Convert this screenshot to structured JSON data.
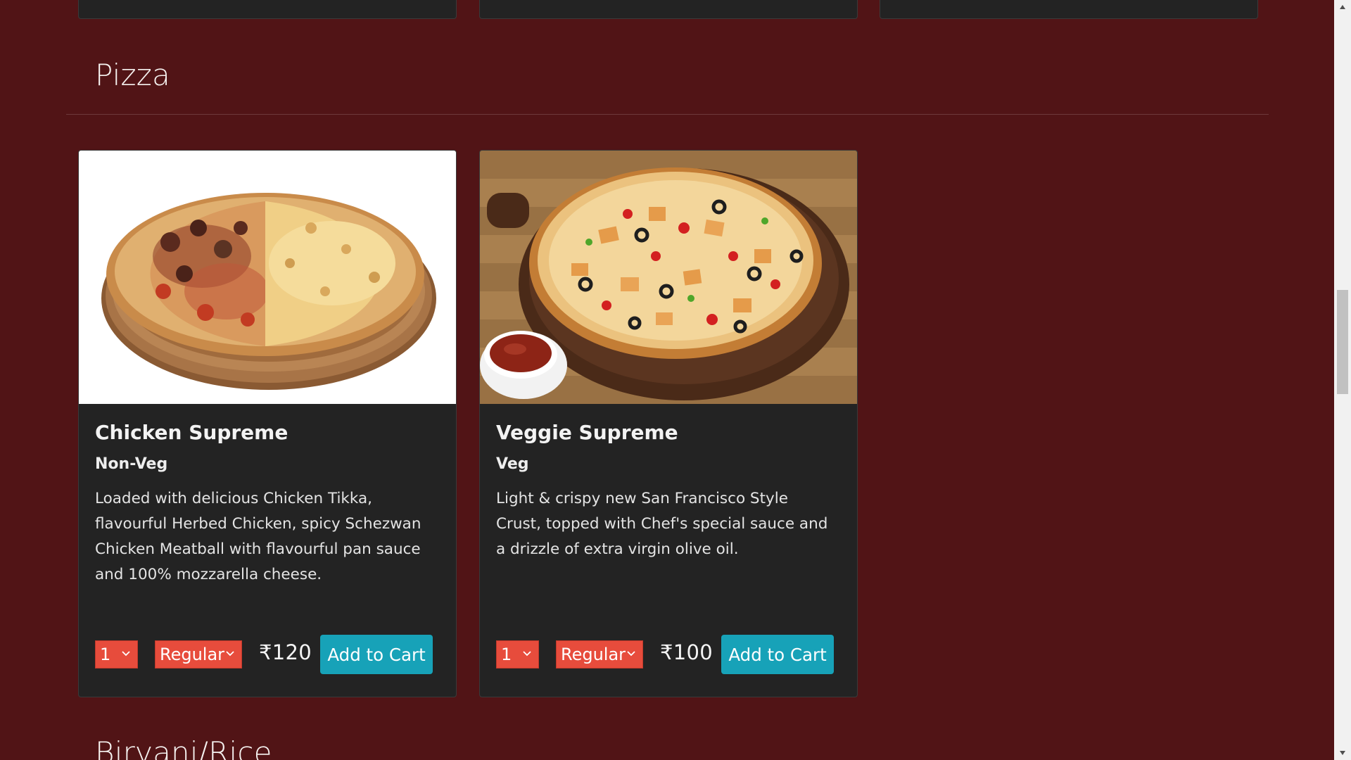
{
  "sections": {
    "pizza": {
      "title": "Pizza",
      "items": [
        {
          "name": "Chicken Supreme",
          "category": "Non-Veg",
          "description": "Loaded with delicious Chicken Tikka, flavourful Herbed Chicken, spicy Schezwan Chicken Meatball with flavourful pan sauce and 100% mozzarella cheese.",
          "quantity": "1",
          "size": "Regular",
          "price": "₹120",
          "add_label": "Add to Cart"
        },
        {
          "name": "Veggie Supreme",
          "category": "Veg",
          "description": "Light & crispy new San Francisco Style Crust, topped with Chef's special sauce and a drizzle of extra virgin olive oil.",
          "quantity": "1",
          "size": "Regular",
          "price": "₹100",
          "add_label": "Add to Cart"
        }
      ]
    },
    "next": {
      "title": "Biryani/Rice"
    }
  },
  "colors": {
    "page_background": "#511416",
    "card_background": "#232323",
    "select_background": "#e74c3c",
    "button_background": "#17a2b8"
  },
  "icons": {
    "select_caret": "chevron-down-icon",
    "scroll_up": "triangle-up-icon",
    "scroll_down": "triangle-down-icon"
  }
}
